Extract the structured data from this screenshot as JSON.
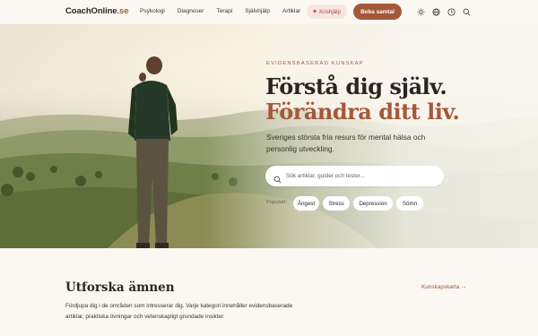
{
  "header": {
    "logo_main": "CoachOnline",
    "logo_tld": ".se",
    "nav": [
      "Psykologi",
      "Diagnoser",
      "Terapi",
      "Självhjälp",
      "Artiklar"
    ],
    "crisis_label": "Krishjälp",
    "cta_label": "Boka samtal",
    "icons": [
      "sun-icon",
      "globe-icon",
      "clock-icon",
      "search-icon"
    ]
  },
  "hero": {
    "eyebrow": "EVIDENSBASERAD KUNSKAP",
    "title_line1": "Förstå dig själv.",
    "title_line2": "Förändra ditt liv.",
    "subtitle": "Sveriges största fria resurs för mental hälsa och personlig utveckling.",
    "search_placeholder": "Sök artiklar, guider och tester...",
    "popular_label": "Populärt:",
    "chips": [
      "Ångest",
      "Stress",
      "Depression",
      "Sömn"
    ]
  },
  "topics": {
    "title": "Utforska ämnen",
    "link": "Kunskapskarta →",
    "description": "Fördjupa dig i de områden som intresserar dig. Varje kategori innehåller evidensbaserade artiklar, praktiska övningar och vetenskapligt grundade insikter."
  },
  "colors": {
    "accent": "#a4583a",
    "background": "#fbf8f3",
    "crisis_bg": "#f6e6e2",
    "crisis_text": "#b2453a"
  }
}
